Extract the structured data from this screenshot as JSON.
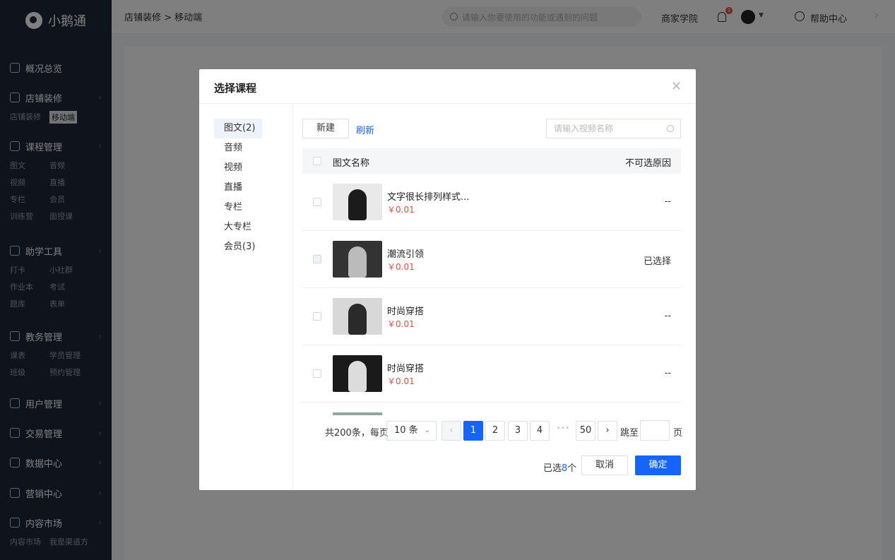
{
  "app": {
    "logo_text": "小鹅通"
  },
  "sidebar": {
    "sections": [
      {
        "label": "概况总览",
        "icon": "dashboard-icon",
        "subs": []
      },
      {
        "label": "店铺装修",
        "icon": "store-icon",
        "subs": [
          "店铺装修",
          "移动端"
        ]
      },
      {
        "label": "课程管理",
        "icon": "course-icon",
        "subs": [
          "图文",
          "音频",
          "视频",
          "直播",
          "专栏",
          "会员",
          "训练营",
          "面授课"
        ]
      },
      {
        "label": "助学工具",
        "icon": "tools-icon",
        "subs": [
          "打卡",
          "小社群",
          "作业本",
          "考试",
          "题库",
          "表单"
        ]
      },
      {
        "label": "教务管理",
        "icon": "teaching-icon",
        "subs": [
          "课表",
          "学员管理",
          "班级",
          "预约管理"
        ]
      },
      {
        "label": "用户管理",
        "icon": "user-icon",
        "subs": []
      },
      {
        "label": "交易管理",
        "icon": "trade-icon",
        "subs": []
      },
      {
        "label": "数据中心",
        "icon": "chart-icon",
        "subs": []
      },
      {
        "label": "营销中心",
        "icon": "marketing-icon",
        "subs": []
      },
      {
        "label": "内容市场",
        "icon": "market-icon",
        "subs": [
          "内容市场",
          "我是渠道方"
        ]
      }
    ]
  },
  "topbar": {
    "breadcrumb": "店铺装修 > 移动端",
    "search_placeholder": "请输入你要使用的功能或遇到的问题",
    "academy": "商家学院",
    "notify_count": "3",
    "help": "帮助中心"
  },
  "modal": {
    "title": "选择课程",
    "categories": [
      "图文(2)",
      "音频",
      "视频",
      "直播",
      "专栏",
      "大专栏",
      "会员(3)"
    ],
    "new_button": "新建",
    "refresh_link": "刷新",
    "search_placeholder": "请输入视频名称",
    "col_name": "图文名称",
    "col_reason": "不可选原因",
    "rows": [
      {
        "name": "文字很长排列样式...",
        "price": "￥0.01",
        "reason": "--"
      },
      {
        "name": "潮流引领",
        "price": "￥0.01",
        "reason": "已选择"
      },
      {
        "name": "时尚穿搭",
        "price": "￥0.01",
        "reason": "--"
      },
      {
        "name": "时尚穿搭",
        "price": "￥0.01",
        "reason": "--"
      }
    ],
    "pagination": {
      "total": "共200条，每页",
      "page_size": "10 条",
      "pages": [
        "1",
        "2",
        "3",
        "4"
      ],
      "ellipsis": "•••",
      "last": "50",
      "jump_label": "跳至",
      "page_unit": "页"
    },
    "selected_prefix": "已选",
    "selected_count": "8",
    "selected_suffix": "个",
    "cancel": "取消",
    "confirm": "确定"
  }
}
